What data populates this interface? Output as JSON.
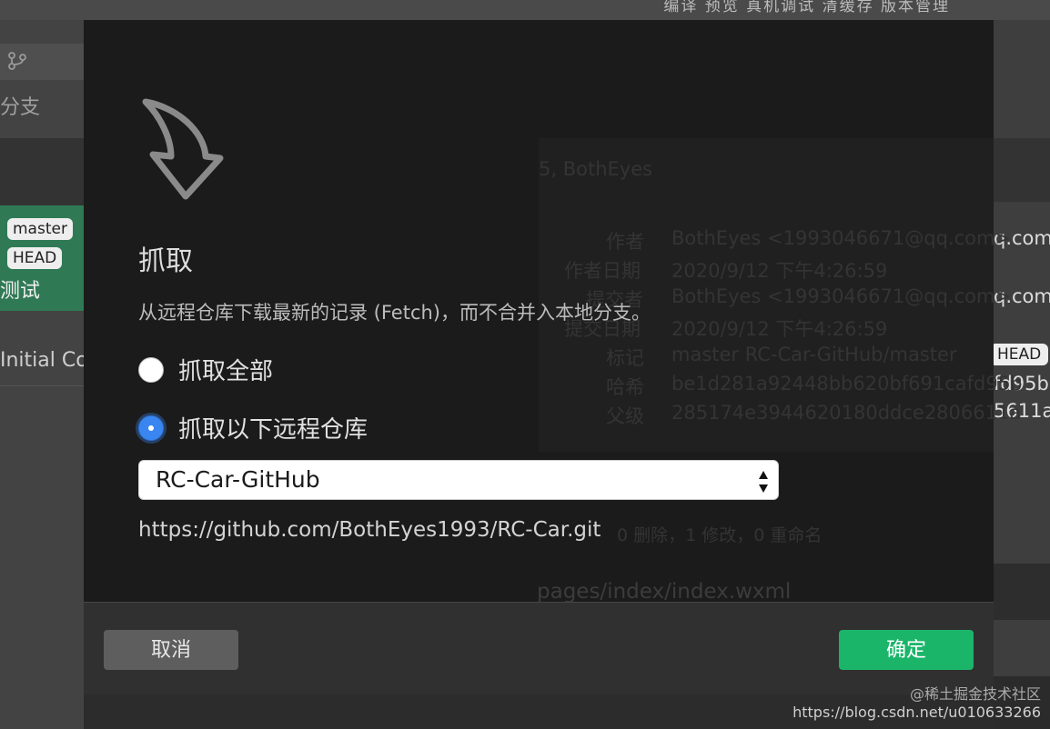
{
  "background": {
    "menu_text": "编译 预览 真机调试 清缓存 版本管理",
    "branch_label": "分支",
    "tags": [
      "master",
      "HEAD"
    ],
    "test_label": "测试",
    "initial_commit": "Initial Cor",
    "right_texts": [
      "q.com>",
      "q.com>",
      "fd95b",
      "5611a"
    ],
    "right_tag": "HEAD",
    "ghost": {
      "author_line": "5, BothEyes",
      "author_label": "作者",
      "author_value": "BothEyes <1993046671@qq.com>",
      "author_date_label": "作者日期",
      "author_date_value": "2020/9/12 下午4:26:59",
      "committer_label": "提交者",
      "committer_value": "BothEyes <1993046671@qq.com>",
      "commit_date_label": "提交日期",
      "commit_date_value": "2020/9/12 下午4:26:59",
      "tags_label": "标记",
      "tags_value": "master  RC-Car-GitHub/master",
      "hash_label": "哈希",
      "hash_value": "be1d281a92448bb620bf691cafd95b",
      "parent_label": "父级",
      "parent_value": "285174e3944620180ddce2806611a",
      "changes": "0 删除，1 修改，0 重命名",
      "file": "pages/index/index.wxml"
    }
  },
  "dialog": {
    "title": "抓取",
    "description": "从远程仓库下载最新的记录 (Fetch)，而不合并入本地分支。",
    "options": [
      {
        "label": "抓取全部",
        "selected": false
      },
      {
        "label": "抓取以下远程仓库",
        "selected": true
      }
    ],
    "remote_select": {
      "value": "RC-Car-GitHub"
    },
    "remote_url": "https://github.com/BothEyes1993/RC-Car.git",
    "cancel_label": "取消",
    "confirm_label": "确定"
  },
  "watermark": {
    "line1": "@稀土掘金技术社区",
    "line2": "https://blog.csdn.net/u010633266"
  },
  "colors": {
    "dialog_bg": "#1b1b1b",
    "footer_bg": "#303030",
    "confirm": "#1bb56a",
    "cancel": "#5e5e5e",
    "radio_on": "#3a86f0"
  },
  "icons": {
    "fetch": "curved-down-arrow-icon",
    "branch": "git-branch-icon",
    "select": "up-down-arrows-icon"
  }
}
